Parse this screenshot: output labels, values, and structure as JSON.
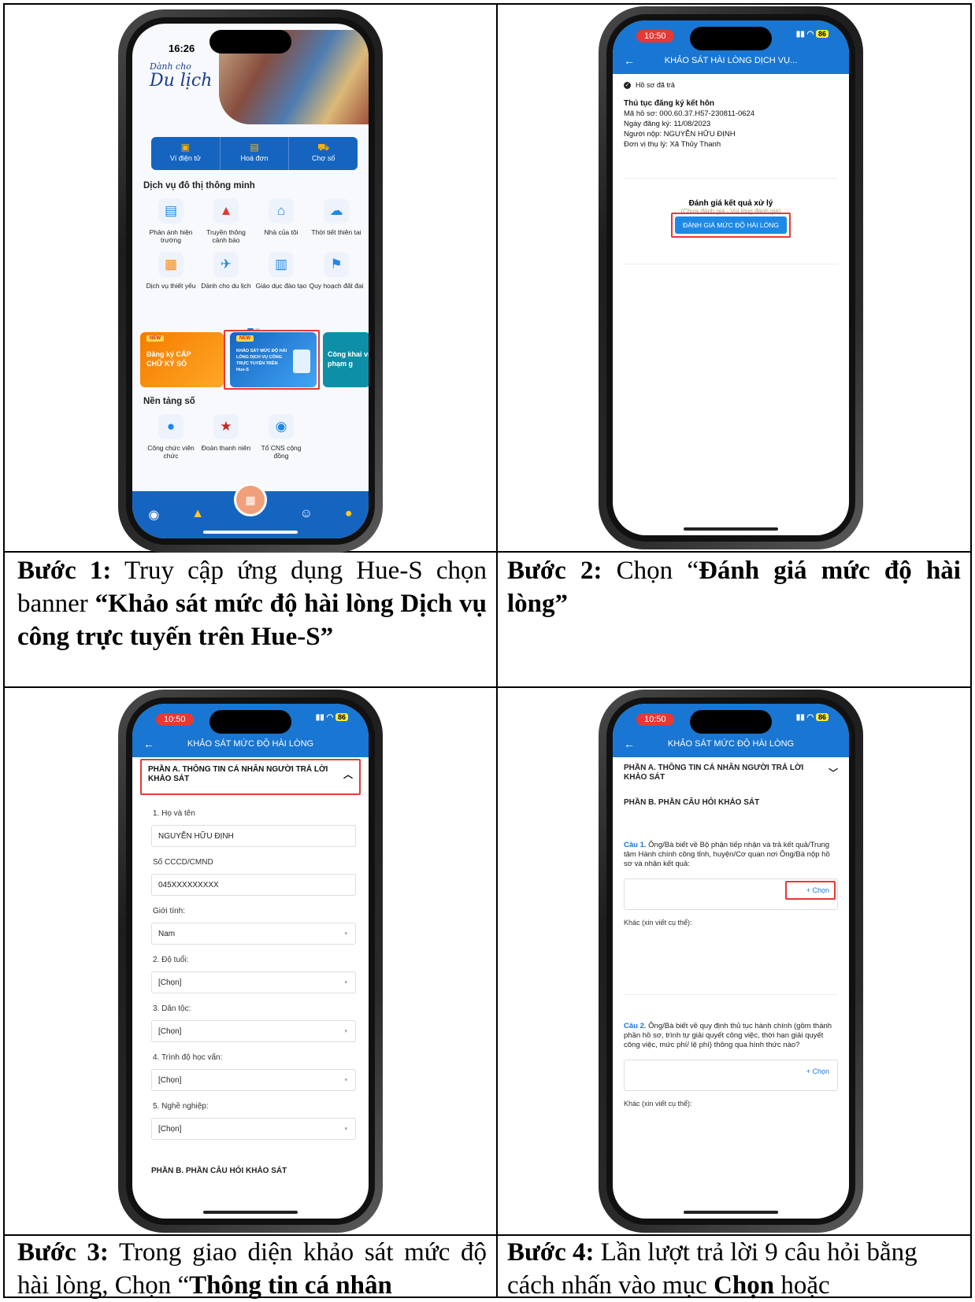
{
  "cells": [
    {
      "step_label": "Bước 1:",
      "step_text": " Truy cập ứng dụng Hue-S chọn banner ",
      "step_bold": "“Khảo sát mức độ hài lòng Dịch vụ công trực tuyến trên Hue-S”"
    },
    {
      "step_label": "Bước 2:",
      "step_text": " Chọn “",
      "step_bold": "Đánh giá mức độ hài lòng”"
    },
    {
      "step_label": "Bước 3:",
      "step_text": " Trong giao diện khảo sát mức độ hài lòng, Chọn “",
      "step_bold": "Thông tin cá nhân"
    },
    {
      "step_label": "Bước 4:",
      "step_text": " Lần lượt trả lời 9 câu hỏi bằng cách nhấn vào mục ",
      "step_bold": "Chọn",
      "step_tail": " hoặc"
    }
  ],
  "phone1": {
    "time": "16:26",
    "brand_small": "Dành cho",
    "brand_big": "Du lịch",
    "wallet": [
      "Ví điện tử",
      "Hoá đơn",
      "Chợ số"
    ],
    "section1": "Dịch vụ đô thị thông minh",
    "icons": [
      {
        "label": "Phản ánh hiện trường",
        "glyph": "▤",
        "color": "#1e88e5"
      },
      {
        "label": "Truyền thông cảnh báo",
        "glyph": "▲",
        "color": "#e53935"
      },
      {
        "label": "Nhà của tôi",
        "glyph": "⌂",
        "color": "#1e88e5"
      },
      {
        "label": "Thời tiết thiên tai",
        "glyph": "☁",
        "color": "#1e88e5"
      },
      {
        "label": "Dịch vụ thiết yếu",
        "glyph": "▦",
        "color": "#fb8c00"
      },
      {
        "label": "Dành cho du lịch",
        "glyph": "✈",
        "color": "#1e88e5"
      },
      {
        "label": "Giáo dục đào tạo",
        "glyph": "▥",
        "color": "#1e88e5"
      },
      {
        "label": "Quy hoạch đất đai",
        "glyph": "⚑",
        "color": "#1e88e5"
      }
    ],
    "banner1_new": "NEW",
    "banner1": "Đăng ký CẤP CHỮ KÝ SỐ",
    "banner2_new": "NEW",
    "banner2": "KHẢO SÁT MỨC ĐỘ HÀI LÒNG DỊCH VỤ CÔNG TRỰC TUYẾN TRÊN Hue-S",
    "banner3": "Công khai vi phạm g",
    "section2": "Nền tảng số",
    "platform": [
      {
        "label": "Công chức viên chức",
        "glyph": "●",
        "color": "#1e88e5"
      },
      {
        "label": "Đoàn thanh niên",
        "glyph": "★",
        "color": "#c62828"
      },
      {
        "label": "Tổ CNS cộng đồng",
        "glyph": "◉",
        "color": "#1e88e5"
      }
    ]
  },
  "phone2": {
    "time": "10:50",
    "battery": "86",
    "title": "KHẢO SÁT HÀI LÒNG DỊCH VỤ...",
    "status": "Hồ sơ đã trả",
    "proc": "Thủ tục đăng ký kết hôn",
    "code": "Mã hồ sơ: 000.60.37.H57-230811-0624",
    "date": "Ngày đăng ký: 11/08/2023",
    "person": "Người nộp: NGUYỄN HỮU ĐỊNH",
    "unit": "Đơn vị thụ lý: Xã Thủy Thanh",
    "eval_title": "Đánh giá kết quả xử lý",
    "eval_sub": "(Chưa đánh giá - Vui lòng đánh giá)",
    "eval_button": "ĐÁNH GIÁ MỨC ĐỘ HÀI LÒNG"
  },
  "phone3": {
    "time": "10:50",
    "battery": "86",
    "title": "KHẢO SÁT MỨC ĐỘ HÀI LÒNG",
    "section_a": "PHẦN A. THÔNG TIN CÁ NHÂN NGƯỜI TRẢ LỜI KHẢO SÁT",
    "fields": [
      {
        "label": "1. Họ và tên",
        "value": "NGUYỄN HỮU ĐỊNH",
        "select": false
      },
      {
        "label": "Số CCCD/CMND",
        "value": "045XXXXXXXXX",
        "select": false
      },
      {
        "label": "Giới tính:",
        "value": "Nam",
        "select": true
      },
      {
        "label": "2. Độ tuổi:",
        "value": "[Chọn]",
        "select": true
      },
      {
        "label": "3. Dân tộc:",
        "value": "[Chọn]",
        "select": true
      },
      {
        "label": "4. Trình độ học vấn:",
        "value": "[Chọn]",
        "select": true
      },
      {
        "label": "5. Nghề nghiệp:",
        "value": "[Chọn]",
        "select": true
      }
    ],
    "section_b": "PHẦN B. PHẦN CÂU HỎI KHẢO SÁT"
  },
  "phone4": {
    "time": "10:50",
    "battery": "86",
    "title": "KHẢO SÁT MỨC ĐỘ HÀI LÒNG",
    "section_a": "PHẦN A. THÔNG TIN CÁ NHÂN NGƯỜI TRẢ LỜI KHẢO SÁT",
    "section_b": "PHẦN B. PHẦN CÂU HỎI KHẢO SÁT",
    "q1_num": "Câu 1.",
    "q1": " Ông/Bà biết về Bộ phận tiếp nhận và trả kết quả/Trung tâm Hành chính công tỉnh, huyện/Cơ quan nơi Ông/Bà nộp hồ sơ và nhận kết quả:",
    "chon": "+ Chọn",
    "other": "Khác (xin viết cụ thể):",
    "q2_num": "Câu 2.",
    "q2": " Ông/Bà biết về quy định thủ tục hành chính (gồm thành phần hồ sơ, trình tự giải quyết công việc, thời hạn giải quyết công việc, mức phí/ lệ phí) thông qua hình thức nào?"
  }
}
